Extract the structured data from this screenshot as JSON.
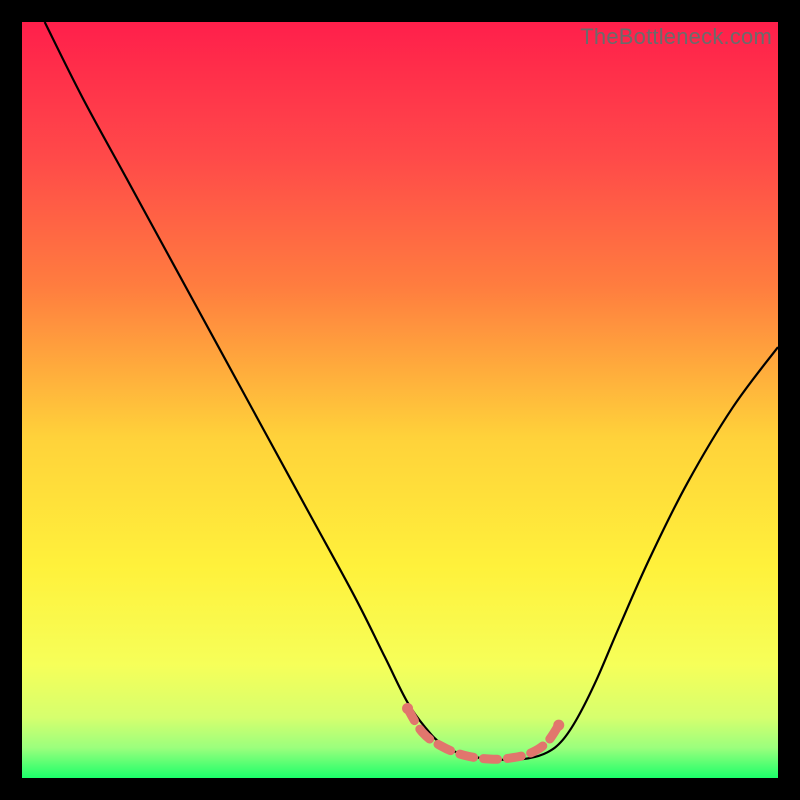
{
  "watermark": "TheBottleneck.com",
  "chart_data": {
    "type": "line",
    "title": "",
    "xlabel": "",
    "ylabel": "",
    "xlim": [
      0,
      100
    ],
    "ylim": [
      0,
      100
    ],
    "grid": false,
    "legend": false,
    "gradient_stops": [
      {
        "offset": 0.0,
        "color": "#ff1f4b"
      },
      {
        "offset": 0.18,
        "color": "#ff4a49"
      },
      {
        "offset": 0.35,
        "color": "#ff7d3f"
      },
      {
        "offset": 0.55,
        "color": "#ffd23a"
      },
      {
        "offset": 0.72,
        "color": "#fff13b"
      },
      {
        "offset": 0.85,
        "color": "#f6ff59"
      },
      {
        "offset": 0.92,
        "color": "#d6ff6e"
      },
      {
        "offset": 0.96,
        "color": "#9bff7d"
      },
      {
        "offset": 1.0,
        "color": "#1cff6a"
      }
    ],
    "series": [
      {
        "name": "curve",
        "color": "#000000",
        "x": [
          3,
          8,
          14,
          20,
          26,
          32,
          38,
          44,
          48,
          51,
          53.5,
          55.5,
          58,
          61,
          64,
          67,
          69.5,
          71.5,
          73.5,
          76,
          79,
          83,
          88,
          94,
          100
        ],
        "y": [
          100,
          90,
          79,
          68,
          57,
          46,
          35,
          24,
          16,
          10,
          6.5,
          4.5,
          3.2,
          2.6,
          2.4,
          2.6,
          3.4,
          5.0,
          8.0,
          13,
          20,
          29,
          39,
          49,
          57
        ]
      }
    ],
    "highlight_segment": {
      "name": "bottom-highlight",
      "color": "#e1766d",
      "dash": [
        14,
        10
      ],
      "width": 9,
      "cap_radius": 5.5,
      "x": [
        51.0,
        53.0,
        55.5,
        58.5,
        62.0,
        65.0,
        67.5,
        69.5,
        71.0
      ],
      "y": [
        9.2,
        6.0,
        4.2,
        3.0,
        2.5,
        2.7,
        3.4,
        4.8,
        7.0
      ]
    }
  }
}
